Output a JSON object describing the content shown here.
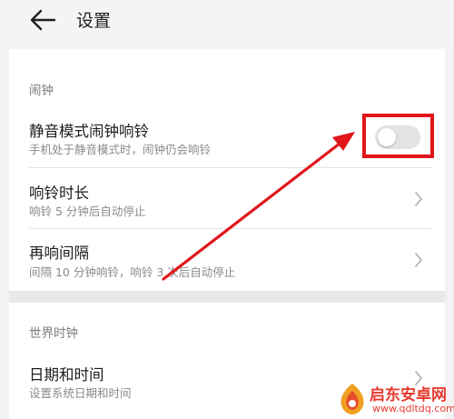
{
  "header": {
    "back_icon": "arrow-left-icon",
    "title": "设置"
  },
  "alarm_section": {
    "label": "闹钟",
    "items": [
      {
        "title": "静音模式闹钟响铃",
        "subtitle": "手机处于静音模式时，闹钟仍会响铃",
        "control": "toggle",
        "toggle_on": false
      },
      {
        "title": "响铃时长",
        "subtitle": "响铃 5 分钟后自动停止",
        "control": "chevron-right-icon"
      },
      {
        "title": "再响间隔",
        "subtitle": "间隔 10 分钟响铃，响铃 3 次后自动停止",
        "control": "chevron-right-icon"
      }
    ]
  },
  "world_clock_section": {
    "label": "世界时钟",
    "items": [
      {
        "title": "日期和时间",
        "subtitle": "设置系统日期和时间",
        "control": "chevron-right-icon"
      }
    ]
  },
  "annotation": {
    "highlight_color": "#e0161b",
    "arrow_color": "#e0161b"
  },
  "watermark": {
    "text": "启东安卓网",
    "url": "www.qdltdq.com",
    "color": "#e83a2f"
  },
  "colors": {
    "background": "#f2f2f2",
    "card": "#ffffff",
    "section_label": "#7d7d7d",
    "subtitle": "#8a8a8a",
    "toggle_off_track": "#e3e3e3"
  }
}
